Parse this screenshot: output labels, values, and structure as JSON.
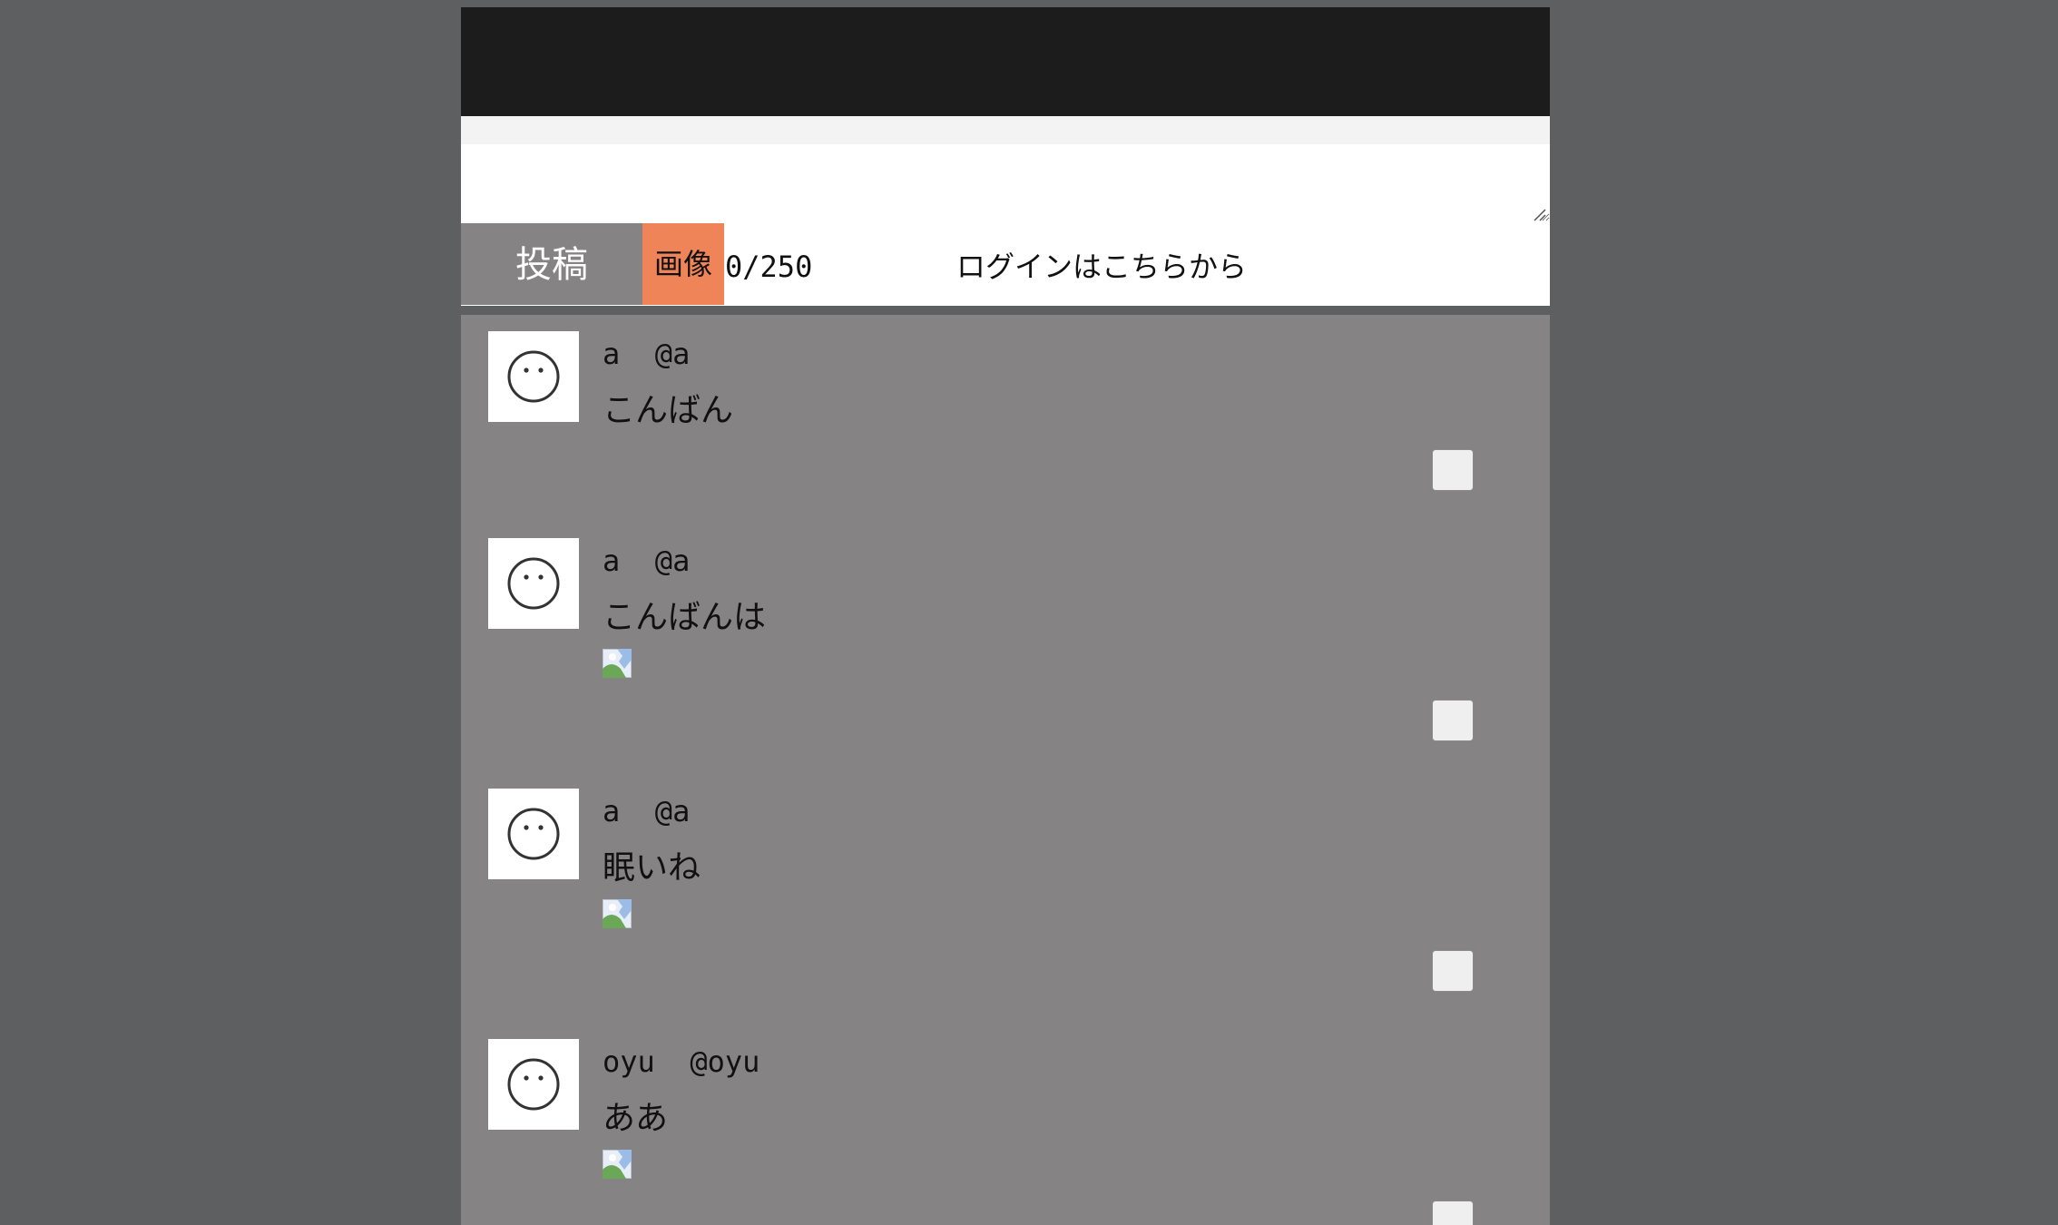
{
  "compose": {
    "textarea_value": "",
    "post_button": "投稿",
    "image_button": "画像",
    "char_count": "0/250",
    "login_link": "ログインはこちらから"
  },
  "colors": {
    "page_bg": "#5e5f61",
    "header_bg": "#1c1c1c",
    "feed_bg": "#858384",
    "image_button_bg": "#ef8458"
  },
  "posts": [
    {
      "name": "a",
      "handle": "@a",
      "text": "こんばん",
      "has_image": false
    },
    {
      "name": "a",
      "handle": "@a",
      "text": "こんばんは",
      "has_image": true
    },
    {
      "name": "a",
      "handle": "@a",
      "text": "眠いね",
      "has_image": true
    },
    {
      "name": "oyu",
      "handle": "@oyu",
      "text": "ああ",
      "has_image": true
    }
  ],
  "icons": {
    "avatar": "neutral-face-icon",
    "post_image": "broken-image-icon",
    "resize": "resize-grip-icon"
  }
}
